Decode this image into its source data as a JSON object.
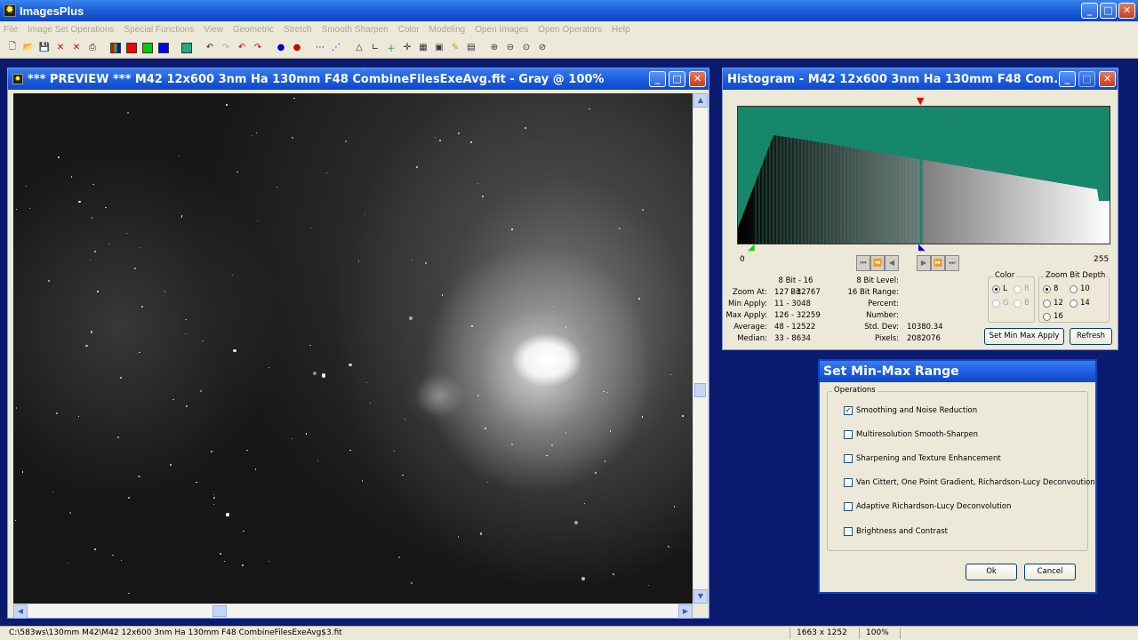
{
  "app": {
    "title": "ImagesPlus"
  },
  "menu": [
    "File",
    "Image Set Operations",
    "Special Functions",
    "View",
    "Geometric",
    "Stretch",
    "Smooth Sharpen",
    "Color",
    "Modeling",
    "Open Images",
    "Open Operators",
    "Help"
  ],
  "preview": {
    "title": "*** PREVIEW *** M42 12x600 3nm Ha 130mm F48 CombineFilesExeAvg.fit - Gray @ 100%"
  },
  "histogram": {
    "title": "Histogram - M42 12x600 3nm Ha 130mm F48 Com...",
    "axis_min": "0",
    "axis_max": "255",
    "stats_header": "8 Bit - 16 Bit",
    "stats_labels": [
      "Zoom At:",
      "Min Apply:",
      "Max Apply:",
      "Average:",
      "Median:"
    ],
    "stats_values": [
      "127 - 32767",
      "11 - 3048",
      "126 - 32259",
      "48 - 12522",
      "33 - 8634"
    ],
    "level_labels": [
      "8 Bit Level:",
      "16 Bit Range:",
      "Percent:",
      "Number:",
      "Std. Dev:",
      "Pixels:"
    ],
    "level_values": [
      "",
      "",
      "",
      "",
      "10380.34",
      "2082076"
    ],
    "color_group": "Color",
    "color_options": [
      "L",
      "R",
      "G",
      "B"
    ],
    "zoom_group": "Zoom Bit Depth",
    "zoom_options": [
      "8",
      "10",
      "12",
      "14",
      "16"
    ],
    "set_button": "Set Min Max Apply",
    "refresh_button": "Refresh"
  },
  "dialog": {
    "title": "Set Min-Max Range",
    "group": "Operations",
    "options": [
      {
        "label": "Smoothing and Noise Reduction",
        "checked": true
      },
      {
        "label": "Multiresolution Smooth-Sharpen",
        "checked": false
      },
      {
        "label": "Sharpening and Texture Enhancement",
        "checked": false
      },
      {
        "label": "Van Cittert, One Point Gradient,  Richardson-Lucy Deconvoution",
        "checked": false
      },
      {
        "label": "Adaptive Richardson-Lucy Deconvolution",
        "checked": false
      },
      {
        "label": "Brightness and Contrast",
        "checked": false
      }
    ],
    "ok": "Ok",
    "cancel": "Cancel"
  },
  "status": {
    "path": "C:\\583ws\\130mm M42\\M42 12x600 3nm Ha 130mm F48 CombineFilesExeAvg$3.fit",
    "dimensions": "1663 x 1252",
    "zoom": "100%"
  }
}
